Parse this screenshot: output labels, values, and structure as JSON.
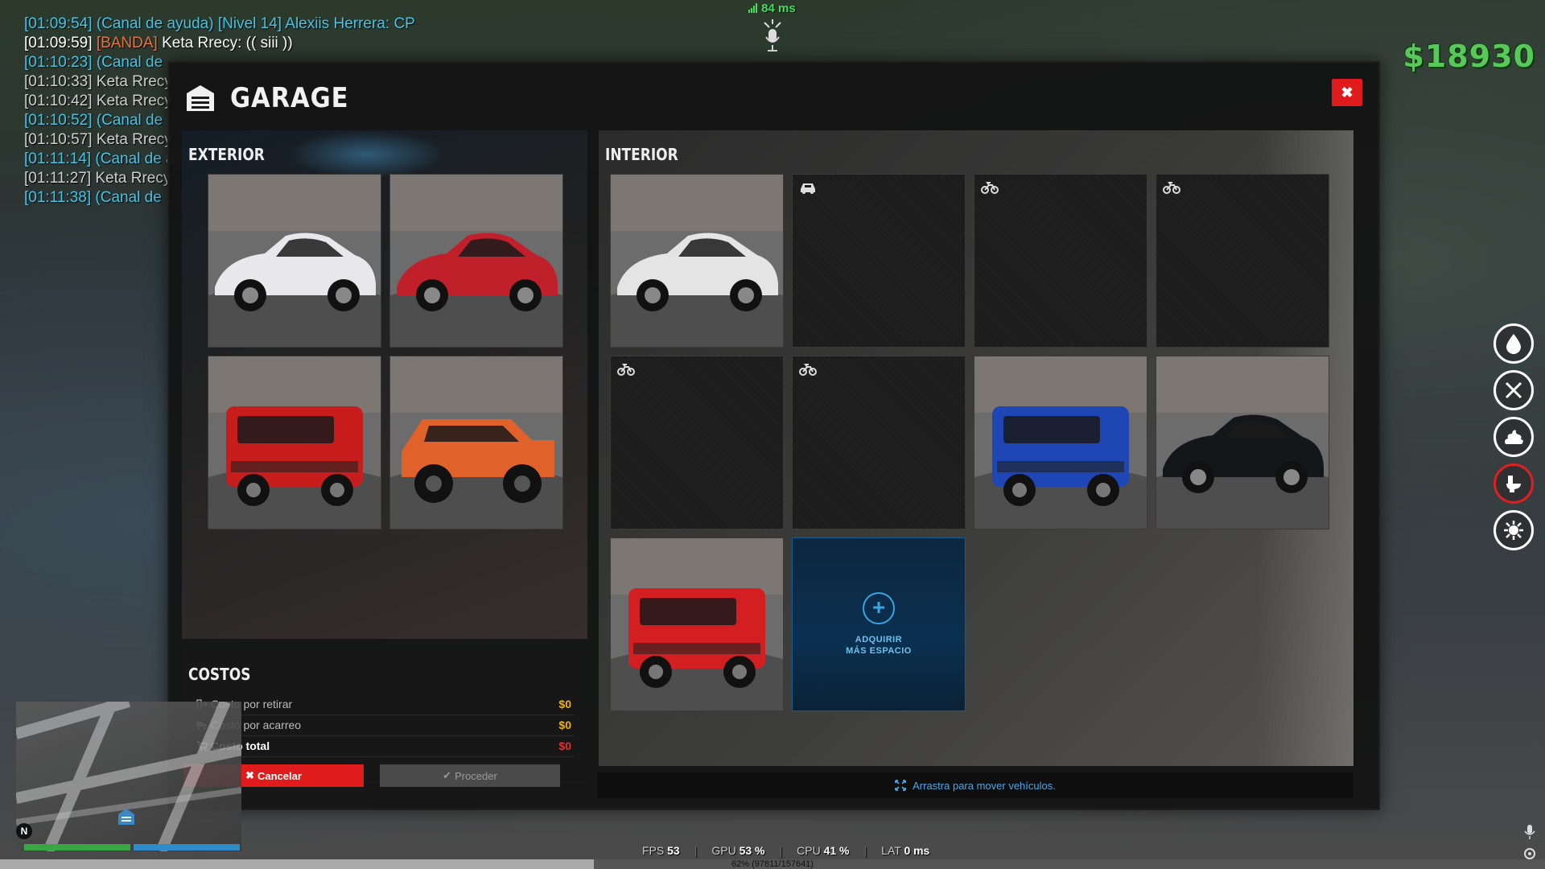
{
  "chat": [
    {
      "time": "[01:09:54]",
      "tag": "(Canal de ayuda) [Nivel 14]",
      "name": " Alexiis Herrera:",
      "msg": " CP",
      "color": "#3fc7e8",
      "tagColor": "#3fc7e8"
    },
    {
      "time": "[01:09:59]",
      "tag": "[BANDA]",
      "name": " Keta Rrecy:",
      "msg": " (( siii ))",
      "color": "#ffffff",
      "tagColor": "#e8743a"
    },
    {
      "time": "[01:10:23]",
      "tag": "(Canal de",
      "name": "",
      "msg": "",
      "color": "#3fc7e8",
      "tagColor": "#3fc7e8"
    },
    {
      "time": "[01:10:33]",
      "tag": "",
      "name": " Keta Rrecy",
      "msg": "",
      "color": "#cfcfcf",
      "tagColor": "#cfcfcf"
    },
    {
      "time": "[01:10:42]",
      "tag": "",
      "name": " Keta Rrecy",
      "msg": "",
      "color": "#cfcfcf",
      "tagColor": "#cfcfcf"
    },
    {
      "time": "[01:10:52]",
      "tag": "(Canal de",
      "name": "",
      "msg": "",
      "color": "#3fc7e8",
      "tagColor": "#3fc7e8"
    },
    {
      "time": "[01:10:57]",
      "tag": "",
      "name": " Keta Rrecy",
      "msg": "",
      "color": "#cfcfcf",
      "tagColor": "#cfcfcf"
    },
    {
      "time": "[01:11:14]",
      "tag": "(Canal de a",
      "name": "",
      "msg": "",
      "color": "#3fc7e8",
      "tagColor": "#3fc7e8"
    },
    {
      "time": "[01:11:27]",
      "tag": "",
      "name": " Keta Rrecy",
      "msg": "",
      "color": "#cfcfcf",
      "tagColor": "#cfcfcf"
    },
    {
      "time": "[01:11:38]",
      "tag": "(Canal de",
      "name": "",
      "msg": "",
      "color": "#3fc7e8",
      "tagColor": "#3fc7e8"
    }
  ],
  "hud": {
    "ping": "84 ms",
    "money": "$18930",
    "compass": "N",
    "fps_label": "FPS",
    "fps": "53",
    "gpu_label": "GPU",
    "gpu": "53 %",
    "cpu_label": "CPU",
    "cpu": "41 %",
    "lat_label": "LAT",
    "lat": "0 ms",
    "load_text": "62% (97811/157641)",
    "load_fraction": 0.62,
    "health_fraction": 1.0,
    "armor_fraction": 1.0
  },
  "status_icons": [
    "water-drop-icon",
    "fork-knife-icon",
    "poop-icon",
    "toilet-icon",
    "virus-icon"
  ],
  "garage": {
    "title": "GARAGE",
    "close_label": "✖",
    "exterior_title": "EXTERIOR",
    "interior_title": "INTERIOR",
    "exterior_slots": [
      {
        "vehicle": "white sedan",
        "color": "#e8e8ea"
      },
      {
        "vehicle": "red supercar",
        "color": "#c0202a"
      },
      {
        "vehicle": "red flatbed truck",
        "color": "#c81d1d"
      },
      {
        "vehicle": "orange pickup",
        "color": "#e0622a"
      }
    ],
    "interior_slots": [
      {
        "state": "vehicle",
        "vehicle": "white hypercar",
        "color": "#e4e4e4"
      },
      {
        "state": "empty",
        "slot_icon": "car-icon"
      },
      {
        "state": "empty",
        "slot_icon": "motorcycle-icon"
      },
      {
        "state": "empty",
        "slot_icon": "motorcycle-icon"
      },
      {
        "state": "empty",
        "slot_icon": "motorcycle-icon"
      },
      {
        "state": "empty",
        "slot_icon": "motorcycle-icon"
      },
      {
        "state": "vehicle",
        "vehicle": "blue offroad van",
        "color": "#1e46b4"
      },
      {
        "state": "vehicle",
        "vehicle": "black roadster",
        "color": "#15161a"
      },
      {
        "state": "vehicle",
        "vehicle": "red van",
        "color": "#d41f22"
      },
      {
        "state": "buy",
        "line1": "ADQUIRIR",
        "line2": "MÁS ESPACIO"
      }
    ],
    "costs": {
      "title": "COSTOS",
      "rows": [
        {
          "label": "Costo por retirar",
          "value": "$0"
        },
        {
          "label": "Costo por acarreo",
          "value": "$0"
        },
        {
          "label": "Costo total",
          "value": "$0"
        }
      ]
    },
    "cancel_label": "Cancelar",
    "proceed_label": "Proceder",
    "drag_hint": "Arrastra para mover vehículos."
  }
}
